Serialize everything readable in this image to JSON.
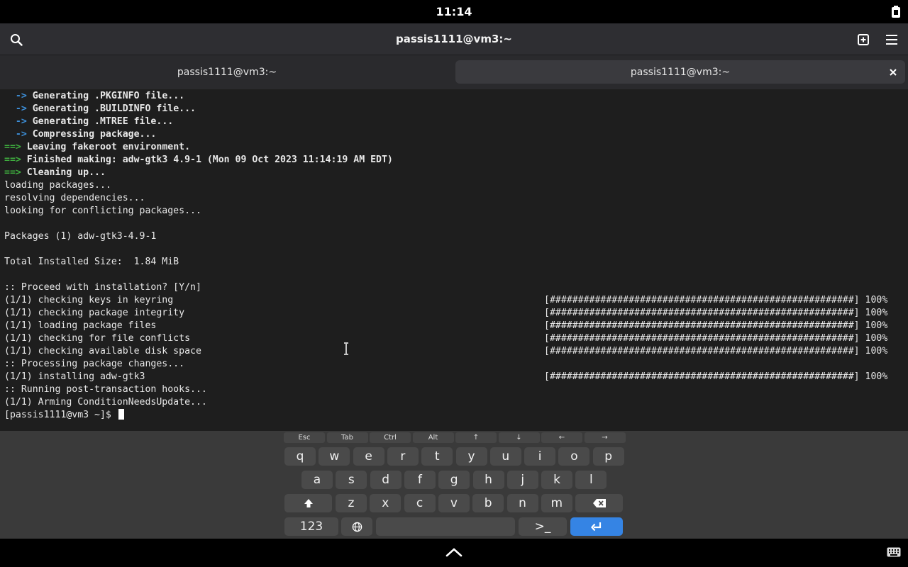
{
  "status": {
    "time": "11:14"
  },
  "header": {
    "title": "passis1111@vm3:~"
  },
  "tabs": [
    {
      "label": "passis1111@vm3:~",
      "active": false
    },
    {
      "label": "passis1111@vm3:~",
      "active": true
    }
  ],
  "terminal": {
    "lines": [
      {
        "prefix": "  ->",
        "text": " Generating .PKGINFO file...",
        "style": "blue"
      },
      {
        "prefix": "  ->",
        "text": " Generating .BUILDINFO file...",
        "style": "blue"
      },
      {
        "prefix": "  ->",
        "text": " Generating .MTREE file...",
        "style": "blue"
      },
      {
        "prefix": "  ->",
        "text": " Compressing package...",
        "style": "blue"
      },
      {
        "prefix": "==>",
        "text": " Leaving fakeroot environment.",
        "style": "green"
      },
      {
        "prefix": "==>",
        "text": " Finished making: adw-gtk3 4.9-1 (Mon 09 Oct 2023 11:14:19 AM EDT)",
        "style": "green"
      },
      {
        "prefix": "==>",
        "text": " Cleaning up...",
        "style": "green"
      },
      {
        "prefix": "",
        "text": "loading packages...",
        "style": "plain"
      },
      {
        "prefix": "",
        "text": "resolving dependencies...",
        "style": "plain"
      },
      {
        "prefix": "",
        "text": "looking for conflicting packages...",
        "style": "plain"
      },
      {
        "prefix": "",
        "text": "",
        "style": "plain"
      },
      {
        "prefix": "",
        "text": "Packages (1) adw-gtk3-4.9-1",
        "style": "plain"
      },
      {
        "prefix": "",
        "text": "",
        "style": "plain"
      },
      {
        "prefix": "",
        "text": "Total Installed Size:  1.84 MiB",
        "style": "plain"
      },
      {
        "prefix": "",
        "text": "",
        "style": "plain"
      },
      {
        "prefix": "",
        "text": ":: Proceed with installation? [Y/n]",
        "style": "plain"
      },
      {
        "prefix": "",
        "text": "(1/1) checking keys in keyring",
        "style": "plain",
        "progress": "[######################################################] 100%"
      },
      {
        "prefix": "",
        "text": "(1/1) checking package integrity",
        "style": "plain",
        "progress": "[######################################################] 100%"
      },
      {
        "prefix": "",
        "text": "(1/1) loading package files",
        "style": "plain",
        "progress": "[######################################################] 100%"
      },
      {
        "prefix": "",
        "text": "(1/1) checking for file conflicts",
        "style": "plain",
        "progress": "[######################################################] 100%"
      },
      {
        "prefix": "",
        "text": "(1/1) checking available disk space",
        "style": "plain",
        "progress": "[######################################################] 100%"
      },
      {
        "prefix": "",
        "text": ":: Processing package changes...",
        "style": "plain"
      },
      {
        "prefix": "",
        "text": "(1/1) installing adw-gtk3",
        "style": "plain",
        "progress": "[######################################################] 100%"
      },
      {
        "prefix": "",
        "text": ":: Running post-transaction hooks...",
        "style": "plain"
      },
      {
        "prefix": "",
        "text": "(1/1) Arming ConditionNeedsUpdate...",
        "style": "plain"
      }
    ],
    "prompt": "[passis1111@vm3 ~]$ "
  },
  "keyboard": {
    "function_keys": [
      "Esc",
      "Tab",
      "Ctrl",
      "Alt",
      "↑",
      "↓",
      "←",
      "→"
    ],
    "row1": [
      "q",
      "w",
      "e",
      "r",
      "t",
      "y",
      "u",
      "i",
      "o",
      "p"
    ],
    "row2": [
      "a",
      "s",
      "d",
      "f",
      "g",
      "h",
      "j",
      "k",
      "l"
    ],
    "row3": [
      "z",
      "x",
      "c",
      "v",
      "b",
      "n",
      "m"
    ],
    "numbers_label": "123",
    "terminal_key_label": ">_"
  },
  "colors": {
    "accent": "#3584e4",
    "arrow_blue": "#3d8fd9",
    "arrow_green": "#3fae3f"
  }
}
